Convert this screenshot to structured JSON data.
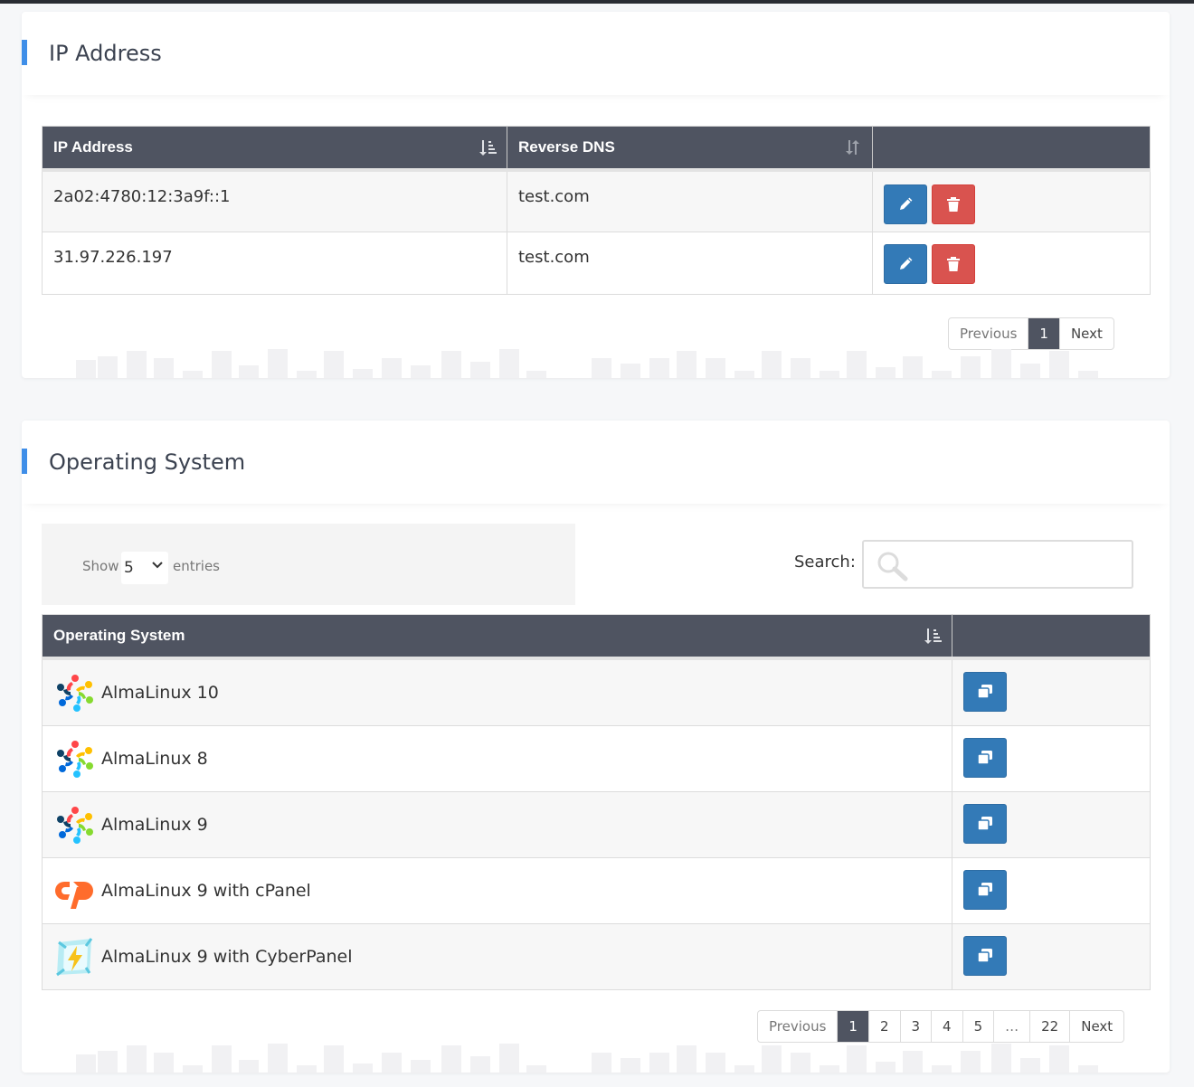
{
  "ip_section": {
    "title": "IP Address",
    "columns": [
      "IP Address",
      "Reverse DNS",
      ""
    ],
    "rows": [
      {
        "ip": "2a02:4780:12:3a9f::1",
        "rdns": "test.com"
      },
      {
        "ip": "31.97.226.197",
        "rdns": "test.com"
      }
    ],
    "pagination": {
      "previous": "Previous",
      "current": "1",
      "next": "Next"
    }
  },
  "os_section": {
    "title": "Operating System",
    "length": {
      "show": "Show",
      "value": "5",
      "entries": "entries"
    },
    "search": {
      "label": "Search:",
      "placeholder": ""
    },
    "columns": [
      "Operating System",
      ""
    ],
    "rows": [
      {
        "name": "AlmaLinux 10",
        "icon": "almalinux-logo-icon"
      },
      {
        "name": "AlmaLinux 8",
        "icon": "almalinux-logo-icon"
      },
      {
        "name": "AlmaLinux 9",
        "icon": "almalinux-logo-icon"
      },
      {
        "name": "AlmaLinux 9 with cPanel",
        "icon": "cpanel-logo-icon"
      },
      {
        "name": "AlmaLinux 9 with CyberPanel",
        "icon": "cyberpanel-logo-icon"
      }
    ],
    "pagination": {
      "previous": "Previous",
      "pages": [
        "1",
        "2",
        "3",
        "4",
        "5",
        "…",
        "22"
      ],
      "next": "Next"
    }
  },
  "colors": {
    "accent": "#3f8ee8",
    "table_header": "#4f5461",
    "edit_button": "#337ab7",
    "delete_button": "#d9534f"
  }
}
